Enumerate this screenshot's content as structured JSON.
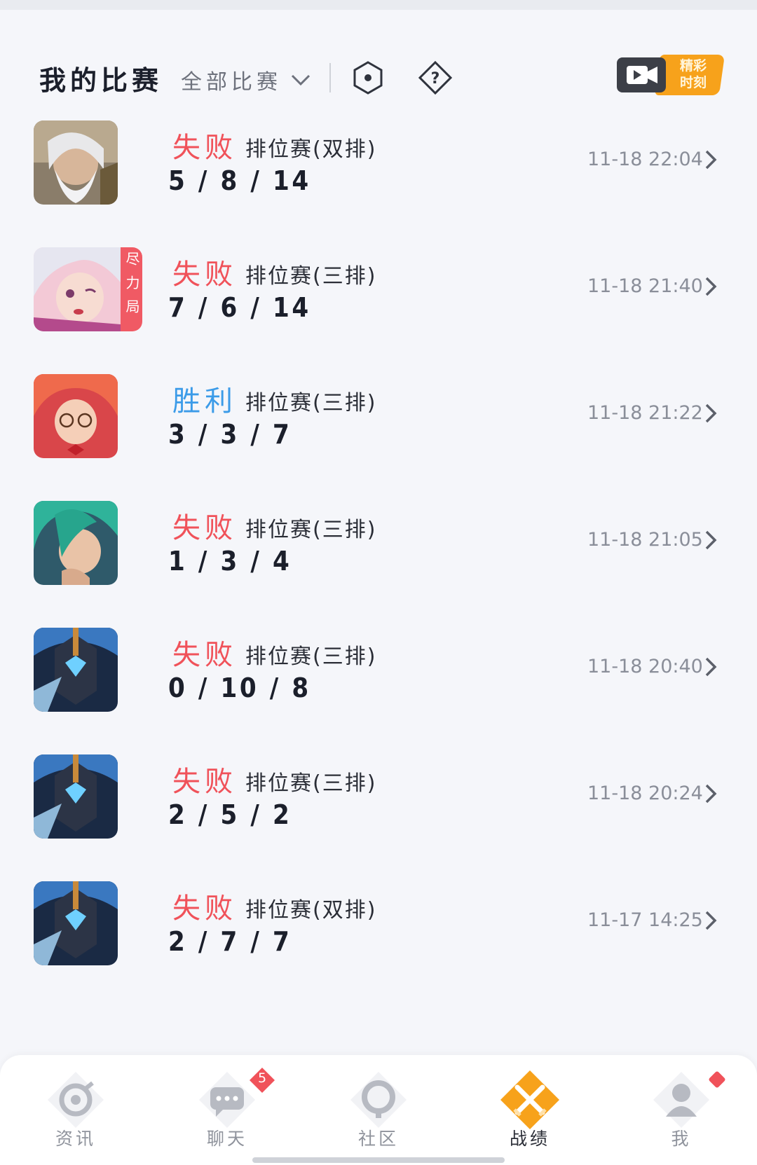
{
  "header": {
    "title": "我的比赛",
    "filter_label": "全部比赛",
    "highlight_label_line1": "精彩",
    "highlight_label_line2": "时刻"
  },
  "matches": [
    {
      "result": "失败",
      "result_type": "lose",
      "mode": "排位赛(双排)",
      "kda": "5 / 8 / 14",
      "time": "11-18 22:04",
      "avatar": "white-bearded-mage-portrait",
      "tag": ""
    },
    {
      "result": "失败",
      "result_type": "lose",
      "mode": "排位赛(三排)",
      "kda": "7 / 6 / 14",
      "time": "11-18 21:40",
      "avatar": "white-haired-girl-portrait",
      "tag": "尽力局"
    },
    {
      "result": "胜利",
      "result_type": "win",
      "mode": "排位赛(三排)",
      "kda": "3 / 3 / 7",
      "time": "11-18 21:22",
      "avatar": "red-haired-glasses-girl-portrait",
      "tag": ""
    },
    {
      "result": "失败",
      "result_type": "lose",
      "mode": "排位赛(三排)",
      "kda": "1 / 3 / 4",
      "time": "11-18 21:05",
      "avatar": "green-haired-sleepy-portrait",
      "tag": ""
    },
    {
      "result": "失败",
      "result_type": "lose",
      "mode": "排位赛(三排)",
      "kda": "0 / 10 / 8",
      "time": "11-18 20:40",
      "avatar": "armored-blue-knight-portrait",
      "tag": ""
    },
    {
      "result": "失败",
      "result_type": "lose",
      "mode": "排位赛(三排)",
      "kda": "2 / 5 / 2",
      "time": "11-18 20:24",
      "avatar": "armored-blue-knight-portrait",
      "tag": ""
    },
    {
      "result": "失败",
      "result_type": "lose",
      "mode": "排位赛(双排)",
      "kda": "2 / 7 / 7",
      "time": "11-17 14:25",
      "avatar": "armored-blue-knight-portrait",
      "tag": ""
    }
  ],
  "tabbar": {
    "tabs": [
      {
        "label": "资讯",
        "icon": "news-icon"
      },
      {
        "label": "聊天",
        "icon": "chat-icon",
        "badge": "5"
      },
      {
        "label": "社区",
        "icon": "community-icon"
      },
      {
        "label": "战绩",
        "icon": "battle-record-icon",
        "active": true
      },
      {
        "label": "我",
        "icon": "profile-icon",
        "dot": true
      }
    ]
  },
  "colors": {
    "lose": "#f0525a",
    "win": "#3b9be8",
    "accent": "#f7a21b"
  }
}
